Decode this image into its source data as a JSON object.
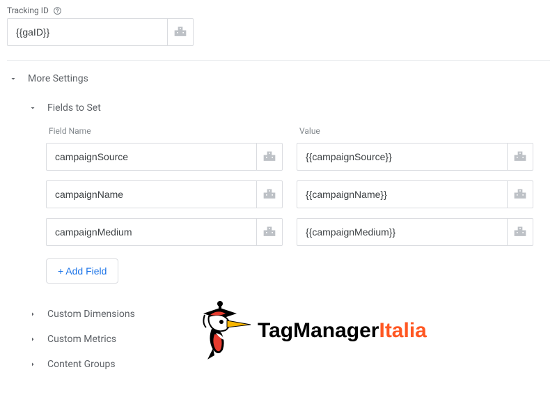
{
  "tracking": {
    "label": "Tracking ID",
    "value": "{{gaID}}"
  },
  "more_settings": {
    "label": "More Settings",
    "fields_to_set": {
      "label": "Fields to Set",
      "col1": "Field Name",
      "col2": "Value",
      "rows": [
        {
          "name": "campaignSource",
          "value": "{{campaignSource}}"
        },
        {
          "name": "campaignName",
          "value": "{{campaignName}}"
        },
        {
          "name": "campaignMedium",
          "value": "{{campaignMedium}}"
        }
      ],
      "add_label": "+ Add Field"
    },
    "collapsed": {
      "custom_dimensions": "Custom Dimensions",
      "custom_metrics": "Custom Metrics",
      "content_groups": "Content Groups"
    }
  },
  "logo": {
    "text1": "TagManager",
    "text2": "Italia"
  }
}
